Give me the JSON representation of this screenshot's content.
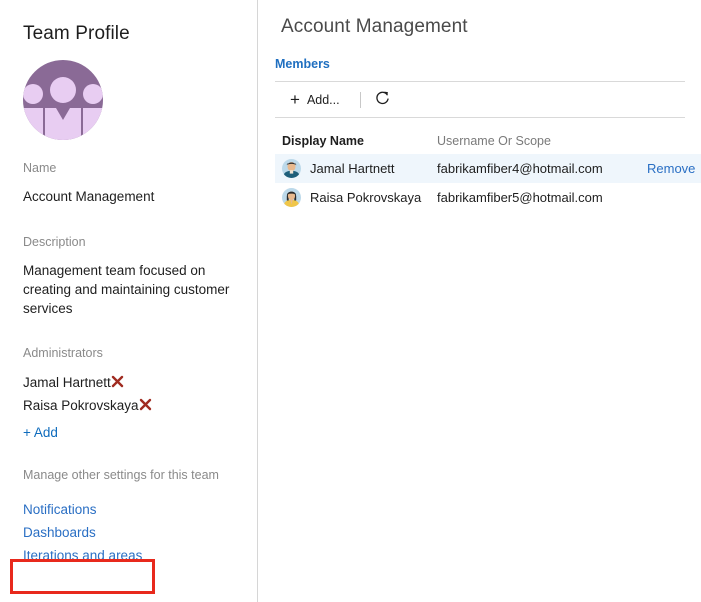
{
  "sidebar": {
    "title": "Team Profile",
    "avatar_icon": "team-group-avatar",
    "avatar_bg_color": "#8a6a96",
    "avatar_fg_color": "#e5c8ee",
    "name": {
      "label": "Name",
      "value": "Account Management"
    },
    "description": {
      "label": "Description",
      "value": "Management team focused on creating and maintaining customer services"
    },
    "administrators": {
      "label": "Administrators",
      "remove_icon": "remove-x-icon",
      "remove_icon_color": "#a02b20",
      "items": [
        {
          "name": "Jamal Hartnett"
        },
        {
          "name": "Raisa Pokrovskaya"
        }
      ],
      "add_label": "Add",
      "add_plus": "+"
    },
    "manage": {
      "heading": "Manage other settings for this team",
      "links": [
        {
          "label": "Notifications"
        },
        {
          "label": "Dashboards"
        },
        {
          "label": "Iterations and areas"
        }
      ]
    },
    "annotation": {
      "target": "Iterations and areas",
      "color": "#e8291c"
    }
  },
  "main": {
    "title": "Account Management",
    "tabs": [
      {
        "label": "Members",
        "active": true
      }
    ],
    "toolbar": {
      "add_label": "Add...",
      "add_icon": "plus-icon",
      "refresh_icon": "refresh-icon"
    },
    "table": {
      "columns": [
        "Display Name",
        "Username Or Scope"
      ],
      "action_label": "Remove",
      "rows": [
        {
          "avatar": "avatar-male-blue",
          "display_name": "Jamal Hartnett",
          "username": "fabrikamfiber4@hotmail.com",
          "selected": true,
          "action": "Remove"
        },
        {
          "avatar": "avatar-female-yellow",
          "display_name": "Raisa Pokrovskaya",
          "username": "fabrikamfiber5@hotmail.com",
          "selected": false,
          "action": ""
        }
      ]
    }
  }
}
